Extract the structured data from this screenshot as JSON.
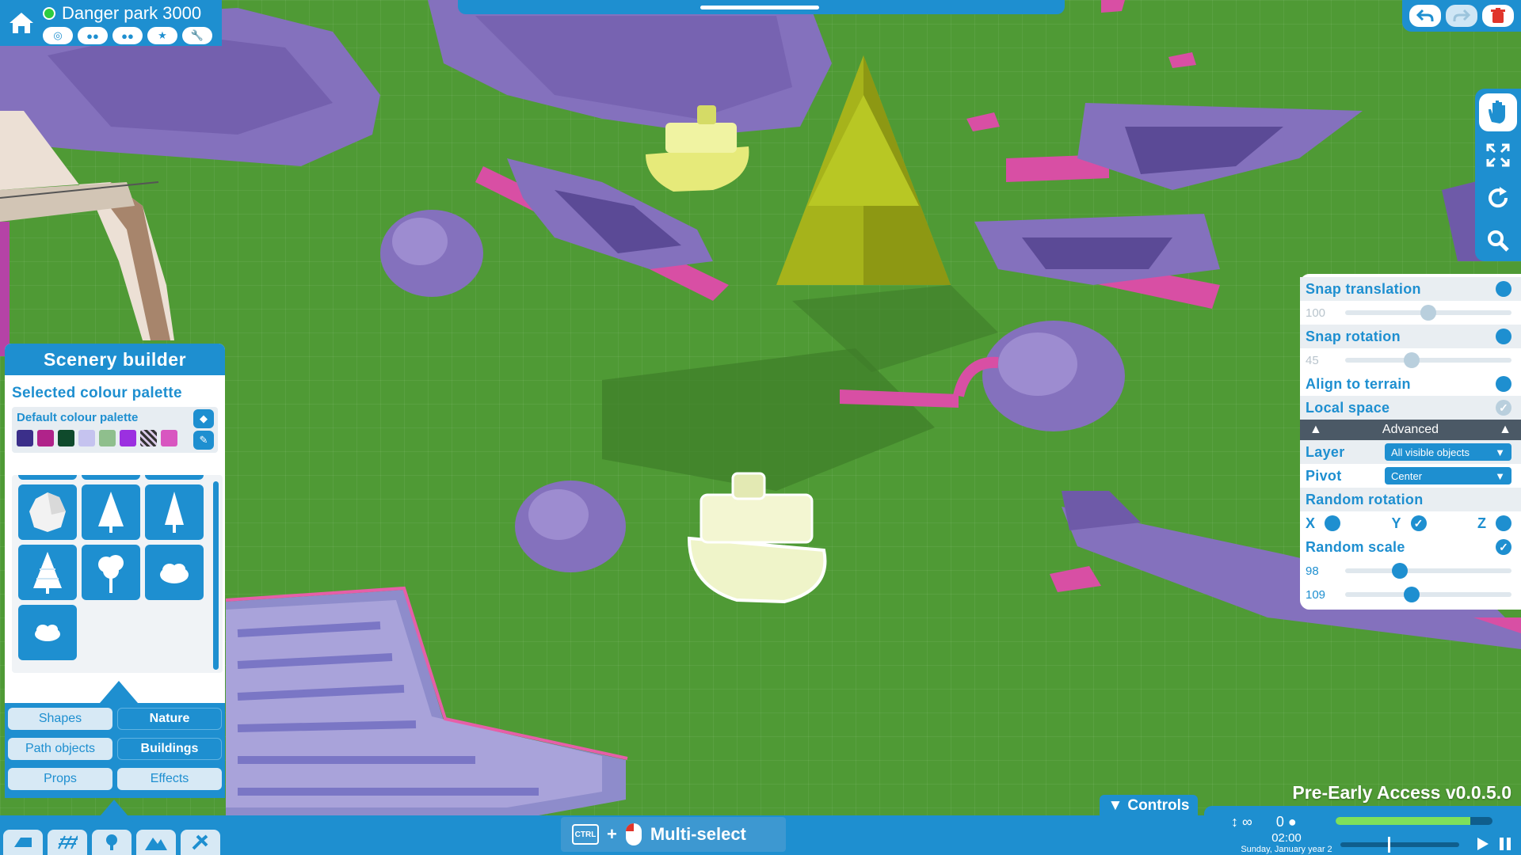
{
  "park": {
    "name": "Danger park 3000",
    "icons": [
      "target-icon",
      "guests-icon",
      "staff-icon",
      "star-icon",
      "wrench-icon"
    ]
  },
  "top_right": {
    "undo": "undo-icon",
    "redo": "redo-icon",
    "delete": "trash-icon"
  },
  "right_tools": [
    "hand-icon",
    "resize-icon",
    "rotate-icon",
    "search-icon"
  ],
  "options": {
    "snap_translation": {
      "label": "Snap translation",
      "value": "100",
      "level": 0.5
    },
    "snap_rotation": {
      "label": "Snap rotation",
      "value": "45",
      "level": 0.4
    },
    "align_to_terrain": {
      "label": "Align to terrain"
    },
    "local_space": {
      "label": "Local space"
    },
    "advanced": {
      "label": "Advanced"
    },
    "layer": {
      "label": "Layer",
      "value": "All visible objects"
    },
    "pivot": {
      "label": "Pivot",
      "value": "Center"
    },
    "random_rotation": {
      "label": "Random rotation",
      "x": "X",
      "y": "Y",
      "z": "Z"
    },
    "random_scale": {
      "label": "Random scale",
      "min": "98",
      "max": "109",
      "min_level": 0.33,
      "max_level": 0.4
    }
  },
  "builder": {
    "title": "Scenery builder",
    "palette_heading": "Selected colour palette",
    "palette_name": "Default colour palette",
    "swatches": [
      "#3b2f8a",
      "#b0238a",
      "#0f4a2c",
      "#c5c3ef",
      "#8fbf8d",
      "#9b30e0",
      "stripes",
      "#d856c0"
    ],
    "categories": [
      {
        "label": "Shapes",
        "active": false
      },
      {
        "label": "Nature",
        "active": true
      },
      {
        "label": "Path objects",
        "active": false
      },
      {
        "label": "Buildings",
        "active": true
      },
      {
        "label": "Props",
        "active": false
      },
      {
        "label": "Effects",
        "active": false
      }
    ],
    "items": [
      "rock-icon",
      "pine-tree-icon",
      "pine-tree-icon",
      "snowy-pine-icon",
      "round-tree-icon",
      "bush-icon",
      "shrub-icon"
    ]
  },
  "bottom": {
    "tools": [
      "build-icon",
      "path-icon",
      "tree-icon",
      "terrain-icon",
      "tools-icon"
    ],
    "ctrl_key": "CTRL",
    "plus": "+",
    "multiselect": "Multi-select",
    "controls": "Controls",
    "version": "Pre-Early Access v0.0.5.0"
  },
  "status": {
    "height": "∞",
    "guests": "0",
    "time": "02:00",
    "date": "Sunday, January year 2",
    "progress": 0.86,
    "speed": 0.4
  }
}
